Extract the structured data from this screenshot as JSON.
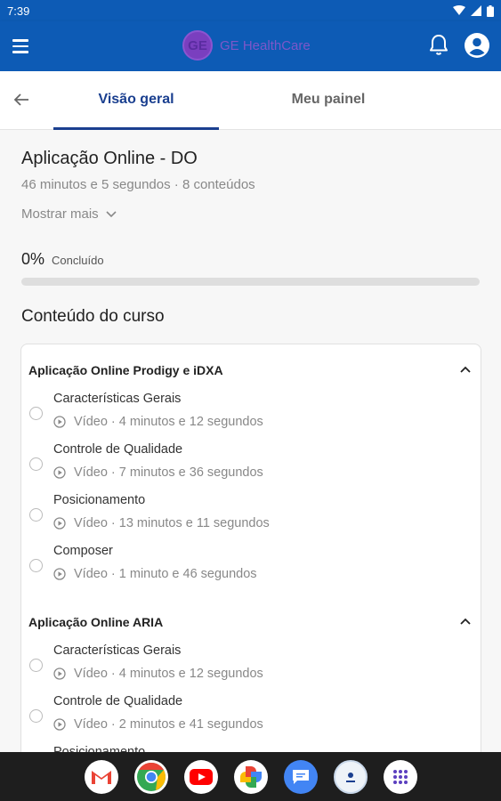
{
  "status": {
    "time": "7:39"
  },
  "app": {
    "brand": "GE HealthCare"
  },
  "tabs": [
    {
      "label": "Visão geral",
      "active": true
    },
    {
      "label": "Meu painel",
      "active": false
    }
  ],
  "course": {
    "title": "Aplicação Online - DO",
    "meta": "46 minutos e 5 segundos · 8 conteúdos",
    "show_more": "Mostrar mais",
    "progress_percent": "0%",
    "progress_value": 0,
    "progress_label": "Concluído"
  },
  "content_heading": "Conteúdo do curso",
  "modules": [
    {
      "title": "Aplicação Online Prodigy e iDXA",
      "lessons": [
        {
          "title": "Características Gerais",
          "meta": "Vídeo · 4 minutos e 12 segundos"
        },
        {
          "title": "Controle de Qualidade",
          "meta": "Vídeo · 7 minutos e 36 segundos"
        },
        {
          "title": "Posicionamento",
          "meta": "Vídeo · 13 minutos e 11 segundos"
        },
        {
          "title": "Composer",
          "meta": "Vídeo · 1 minuto e 46 segundos"
        }
      ]
    },
    {
      "title": "Aplicação Online ARIA",
      "lessons": [
        {
          "title": "Características Gerais",
          "meta": "Vídeo · 4 minutos e 12 segundos"
        },
        {
          "title": "Controle de Qualidade",
          "meta": "Vídeo · 2 minutos e 41 segundos"
        },
        {
          "title": "Posicionamento",
          "meta": ""
        }
      ]
    }
  ],
  "dock": [
    "gmail-icon",
    "chrome-icon",
    "youtube-icon",
    "photos-icon",
    "messages-icon",
    "app-icon",
    "app-drawer-icon"
  ],
  "colors": {
    "primary": "#0d5bb5",
    "accent": "#1a3f8f",
    "logo": "#7a3fbf"
  }
}
